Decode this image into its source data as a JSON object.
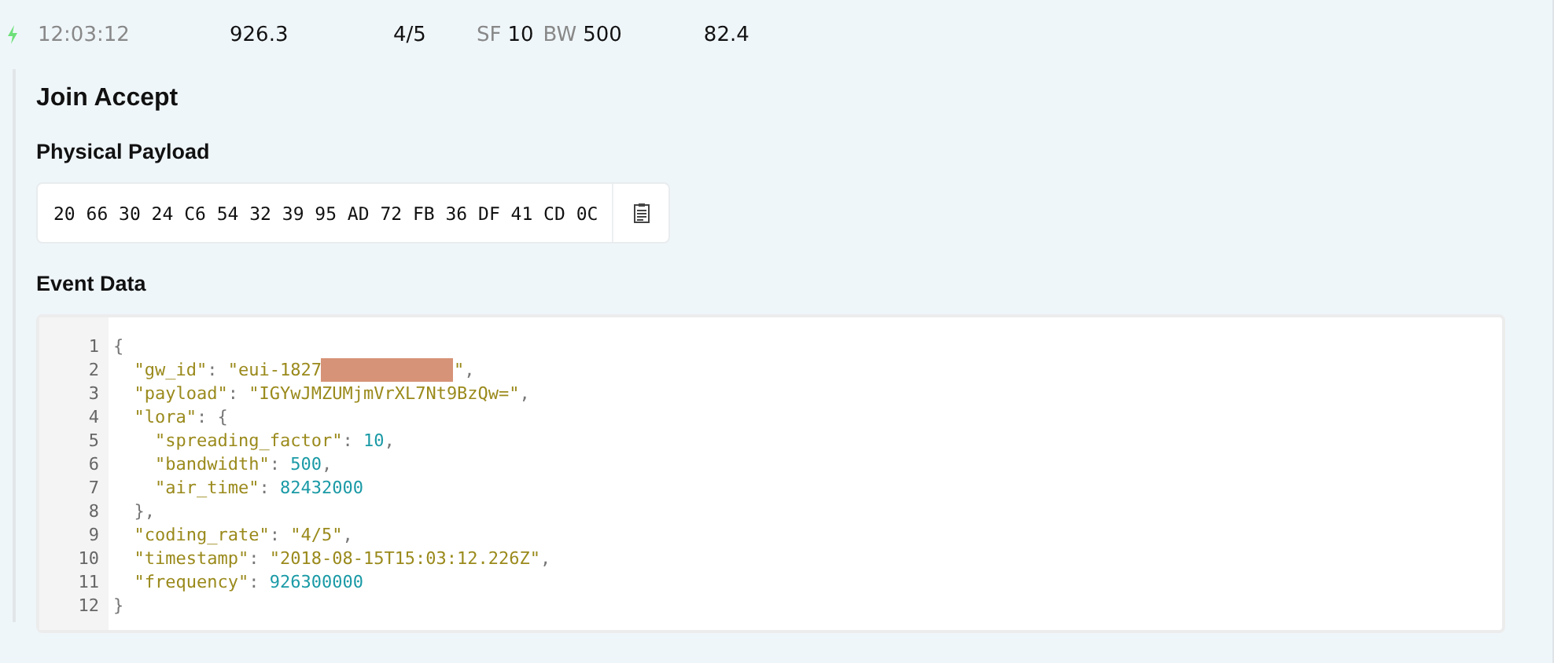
{
  "event_row": {
    "time": "12:03:12",
    "frequency": "926.3",
    "coding_rate": "4/5",
    "sf_label": "SF",
    "sf_value": "10",
    "bw_label": "BW",
    "bw_value": "500",
    "airtime": "82.4"
  },
  "details": {
    "title": "Join Accept",
    "physical_payload": {
      "heading": "Physical Payload",
      "value": "20 66 30 24 C6 54 32 39 95 AD 72 FB 36 DF 41 CD 0C"
    },
    "event_data": {
      "heading": "Event Data",
      "lines": [
        {
          "number": "1",
          "tokens": [
            {
              "kind": "punct",
              "text": "{"
            }
          ]
        },
        {
          "number": "2",
          "tokens": [
            {
              "kind": "key",
              "text": "  \"gw_id\""
            },
            {
              "kind": "punct",
              "text": ": "
            },
            {
              "kind": "string",
              "text": "\"eui-1827"
            },
            {
              "kind": "redacted"
            },
            {
              "kind": "string",
              "text": "\""
            },
            {
              "kind": "punct",
              "text": ","
            }
          ]
        },
        {
          "number": "3",
          "tokens": [
            {
              "kind": "key",
              "text": "  \"payload\""
            },
            {
              "kind": "punct",
              "text": ": "
            },
            {
              "kind": "string",
              "text": "\"IGYwJMZUMjmVrXL7Nt9BzQw=\""
            },
            {
              "kind": "punct",
              "text": ","
            }
          ]
        },
        {
          "number": "4",
          "tokens": [
            {
              "kind": "key",
              "text": "  \"lora\""
            },
            {
              "kind": "punct",
              "text": ": {"
            }
          ]
        },
        {
          "number": "5",
          "tokens": [
            {
              "kind": "key",
              "text": "    \"spreading_factor\""
            },
            {
              "kind": "punct",
              "text": ": "
            },
            {
              "kind": "number",
              "text": "10"
            },
            {
              "kind": "punct",
              "text": ","
            }
          ]
        },
        {
          "number": "6",
          "tokens": [
            {
              "kind": "key",
              "text": "    \"bandwidth\""
            },
            {
              "kind": "punct",
              "text": ": "
            },
            {
              "kind": "number",
              "text": "500"
            },
            {
              "kind": "punct",
              "text": ","
            }
          ]
        },
        {
          "number": "7",
          "tokens": [
            {
              "kind": "key",
              "text": "    \"air_time\""
            },
            {
              "kind": "punct",
              "text": ": "
            },
            {
              "kind": "number",
              "text": "82432000"
            }
          ]
        },
        {
          "number": "8",
          "tokens": [
            {
              "kind": "punct",
              "text": "  },"
            }
          ]
        },
        {
          "number": "9",
          "tokens": [
            {
              "kind": "key",
              "text": "  \"coding_rate\""
            },
            {
              "kind": "punct",
              "text": ": "
            },
            {
              "kind": "string",
              "text": "\"4/5\""
            },
            {
              "kind": "punct",
              "text": ","
            }
          ]
        },
        {
          "number": "10",
          "tokens": [
            {
              "kind": "key",
              "text": "  \"timestamp\""
            },
            {
              "kind": "punct",
              "text": ": "
            },
            {
              "kind": "string",
              "text": "\"2018-08-15T15:03:12.226Z\""
            },
            {
              "kind": "punct",
              "text": ","
            }
          ]
        },
        {
          "number": "11",
          "tokens": [
            {
              "kind": "key",
              "text": "  \"frequency\""
            },
            {
              "kind": "punct",
              "text": ": "
            },
            {
              "kind": "number",
              "text": "926300000"
            }
          ]
        },
        {
          "number": "12",
          "tokens": [
            {
              "kind": "punct",
              "text": "}"
            }
          ]
        }
      ]
    }
  }
}
